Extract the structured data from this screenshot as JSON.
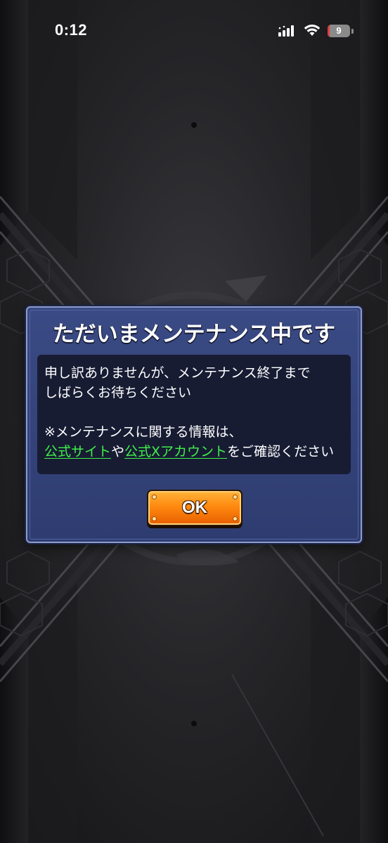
{
  "status_bar": {
    "time": "0:12",
    "battery_level": "9",
    "battery_fraction": 0.09
  },
  "dialog": {
    "title": "ただいまメンテナンス中です",
    "message_line1": "申し訳ありませんが、メンテナンス終了まで",
    "message_line2": "しばらくお待ちください",
    "note_line1": "※メンテナンスに関する情報は、",
    "link_official_site": "公式サイト",
    "connector": "や",
    "link_official_x": "公式Xアカウント",
    "note_suffix": "をご確認ください",
    "ok_label": "OK"
  },
  "colors": {
    "dialog_bg": "#33427a",
    "dialog_border": "#8d9ccc",
    "message_bg": "#171c33",
    "link": "#3ff04a",
    "ok_button": "#ff8a10",
    "battery_low": "#e23b3b"
  },
  "icons": [
    "signal-icon",
    "wifi-icon",
    "battery-icon"
  ]
}
